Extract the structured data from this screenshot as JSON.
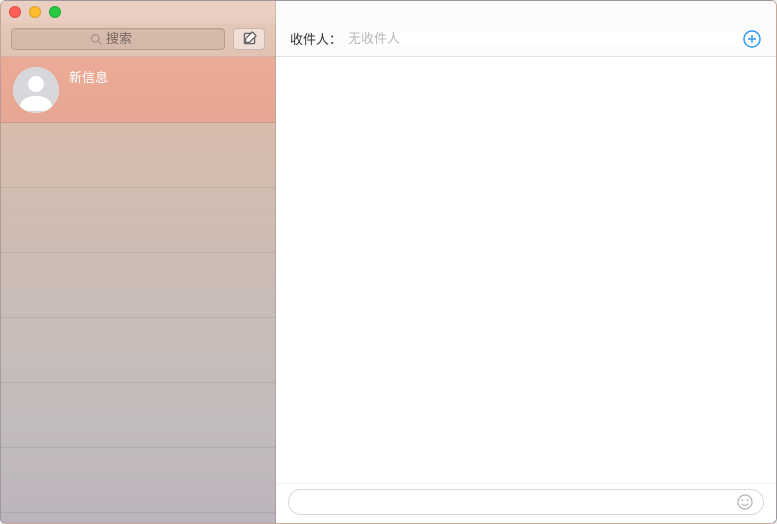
{
  "sidebar": {
    "search_placeholder": "搜索",
    "conversations": [
      {
        "title": "新信息",
        "selected": true
      }
    ]
  },
  "header": {
    "recipient_label": "收件人：",
    "recipient_placeholder": "无收件人"
  },
  "compose": {
    "message_placeholder": ""
  },
  "colors": {
    "accent": "#1e90ff",
    "add_btn": "#2b9af3"
  }
}
